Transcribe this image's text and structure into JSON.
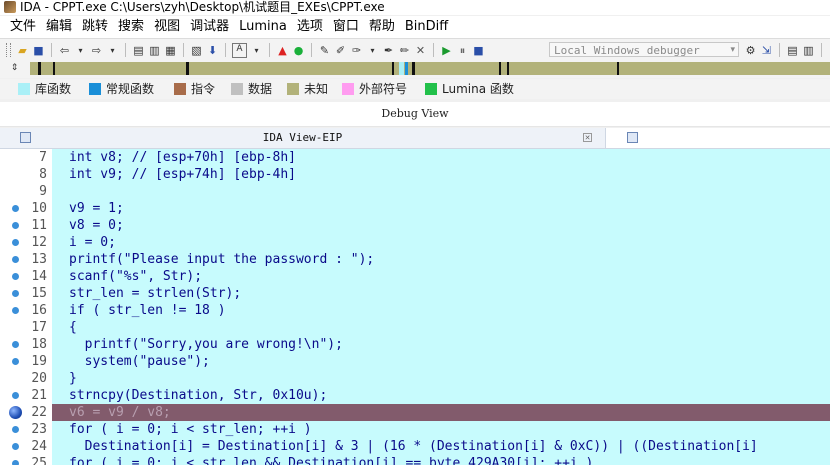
{
  "window": {
    "title": "IDA - CPPT.exe C:\\Users\\zyh\\Desktop\\机试题目_EXEs\\CPPT.exe"
  },
  "menu": [
    "文件",
    "编辑",
    "跳转",
    "搜索",
    "视图",
    "调试器",
    "Lumina",
    "选项",
    "窗口",
    "帮助",
    "BinDiff"
  ],
  "toolbar": {
    "debugger": "Local Windows debugger"
  },
  "legend": [
    {
      "label": "库函数",
      "color": "#aaf0f7"
    },
    {
      "label": "常规函数",
      "color": "#1a8fd8"
    },
    {
      "label": "指令",
      "color": "#a86c4a"
    },
    {
      "label": "数据",
      "color": "#c0c0c0"
    },
    {
      "label": "未知",
      "color": "#b2b27a"
    },
    {
      "label": "外部符号",
      "color": "#ff9cf0"
    },
    {
      "label": "Lumina 函数",
      "color": "#22c04a"
    }
  ],
  "debug_view": {
    "title": "Debug View"
  },
  "tab": {
    "title": "IDA View-EIP"
  },
  "code_lines": [
    {
      "num": "7",
      "text": "int v8; // [esp+70h] [ebp-8h]",
      "dot": false
    },
    {
      "num": "8",
      "text": "int v9; // [esp+74h] [ebp-4h]",
      "dot": false
    },
    {
      "num": "9",
      "text": "",
      "dot": false
    },
    {
      "num": "10",
      "text": "v9 = 1;",
      "dot": true
    },
    {
      "num": "11",
      "text": "v8 = 0;",
      "dot": true
    },
    {
      "num": "12",
      "text": "i = 0;",
      "dot": true
    },
    {
      "num": "13",
      "text": "printf(\"Please input the password : \");",
      "dot": true
    },
    {
      "num": "14",
      "text": "scanf(\"%s\", Str);",
      "dot": true
    },
    {
      "num": "15",
      "text": "str_len = strlen(Str);",
      "dot": true
    },
    {
      "num": "16",
      "text": "if ( str_len != 18 )",
      "dot": true
    },
    {
      "num": "17",
      "text": "{",
      "dot": false
    },
    {
      "num": "18",
      "text": "  printf(\"Sorry,you are wrong!\\n\");",
      "dot": true
    },
    {
      "num": "19",
      "text": "  system(\"pause\");",
      "dot": true
    },
    {
      "num": "20",
      "text": "}",
      "dot": false
    },
    {
      "num": "21",
      "text": "strncpy(Destination, Str, 0x10u);",
      "dot": true
    },
    {
      "num": "22",
      "text": "v6 = v9 / v8;",
      "dot": false,
      "breakpoint": true,
      "highlight": true
    },
    {
      "num": "23",
      "text": "for ( i = 0; i < str_len; ++i )",
      "dot": true
    },
    {
      "num": "24",
      "text": "  Destination[i] = Destination[i] & 3 | (16 * (Destination[i] & 0xC)) | ((Destination[i]",
      "dot": true
    },
    {
      "num": "25",
      "text": "for ( i = 0; i < str_len && Destination[i] == byte_429A30[i]; ++i )",
      "dot": true
    }
  ]
}
